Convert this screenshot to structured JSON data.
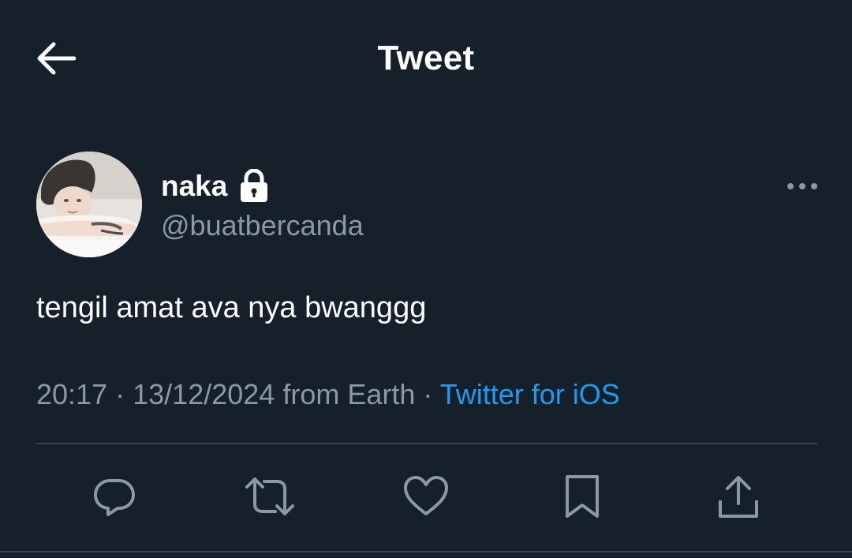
{
  "header": {
    "title": "Tweet",
    "back_icon": "arrow-left-icon"
  },
  "tweet": {
    "author": {
      "name": "naka",
      "handle": "@buatbercanda",
      "protected_icon": "lock-icon"
    },
    "text": "tengil amat ava nya bwanggg",
    "time": "20:17",
    "date": "13/12/2024",
    "location": "from Earth",
    "separator": "·",
    "source": "Twitter for iOS"
  },
  "actions": [
    {
      "name": "reply",
      "icon": "comment-icon"
    },
    {
      "name": "retweet",
      "icon": "retweet-icon"
    },
    {
      "name": "like",
      "icon": "heart-icon"
    },
    {
      "name": "bookmark",
      "icon": "bookmark-icon"
    },
    {
      "name": "share",
      "icon": "share-icon"
    }
  ],
  "colors": {
    "background": "#15202b",
    "text_primary": "#ffffff",
    "text_secondary": "#8b98a5",
    "accent": "#1d9bf0",
    "divider": "#38444d"
  }
}
